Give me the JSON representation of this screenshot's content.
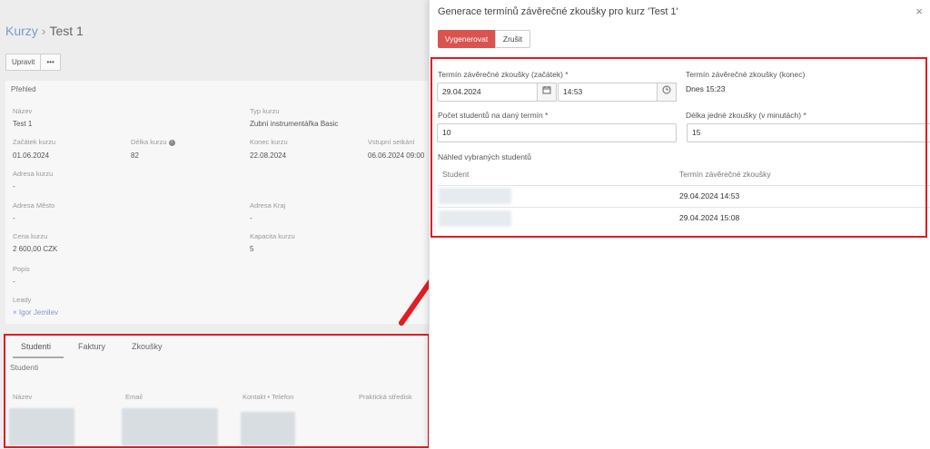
{
  "breadcrumb": {
    "parent": "Kurzy",
    "separator": "›",
    "current": "Test 1"
  },
  "toolbar": {
    "edit_label": "Upravit",
    "more_label": "•••"
  },
  "overview": {
    "heading": "Přehled",
    "fields": {
      "name_label": "Název",
      "name_value": "Test 1",
      "type_label": "Typ kurzu",
      "type_value": "Zubní instrumentářka Basic",
      "start_label": "Začátek kurzu",
      "start_value": "01.06.2024",
      "length_label": "Délka kurzu",
      "length_value": "82",
      "end_label": "Konec kurzu",
      "end_value": "22.08.2024",
      "entry_label": "Vstupní setkání",
      "entry_value": "06.06.2024 09:00",
      "address_label": "Adresa kurzu",
      "address_value": "-",
      "city_label": "Adresa Město",
      "city_value": "-",
      "region_label": "Adresa Kraj",
      "region_value": "-",
      "price_label": "Cena kurzu",
      "price_value": "2 600,00 CZK",
      "capacity_label": "Kapacita kurzu",
      "capacity_value": "5",
      "desc_label": "Popis",
      "desc_value": "-",
      "leads_label": "Leady",
      "leads_value": "× Igor Jemilev"
    }
  },
  "bottom_tabs": {
    "tabs": [
      "Studenti",
      "Faktury",
      "Zkoušky"
    ],
    "section": "Studenti",
    "columns": [
      "Název",
      "Email",
      "Kontakt • Telefon",
      "Praktická středisk"
    ]
  },
  "modal": {
    "title": "Generace termínů závěrečné zkoušky pro kurz 'Test 1'",
    "close": "×",
    "generate_label": "Vygenerovat",
    "cancel_label": "Zrušit",
    "start_label": "Termín závěrečné zkoušky (začátek) *",
    "start_date": "29.04.2024",
    "start_time": "14:53",
    "end_label": "Termín závěrečné zkoušky (konec)",
    "end_value": "Dnes 15:23",
    "students_label": "Počet studentů na daný termín *",
    "students_value": "10",
    "duration_label": "Délka jedné zkoušky (v minutách) *",
    "duration_value": "15",
    "preview_label": "Náhled vybraných studentů",
    "table": {
      "col_student": "Student",
      "col_term": "Termín závěrečné zkoušky",
      "rows": [
        {
          "term": "29.04.2024 14:53"
        },
        {
          "term": "29.04.2024 15:08"
        }
      ]
    }
  },
  "colors": {
    "primary": "#d9534f",
    "annotation": "#e31b23",
    "link": "#7a9ac9"
  },
  "icons": {
    "calendar": "calendar-icon",
    "clock": "clock-icon",
    "close": "close-icon",
    "info": "info-icon"
  }
}
